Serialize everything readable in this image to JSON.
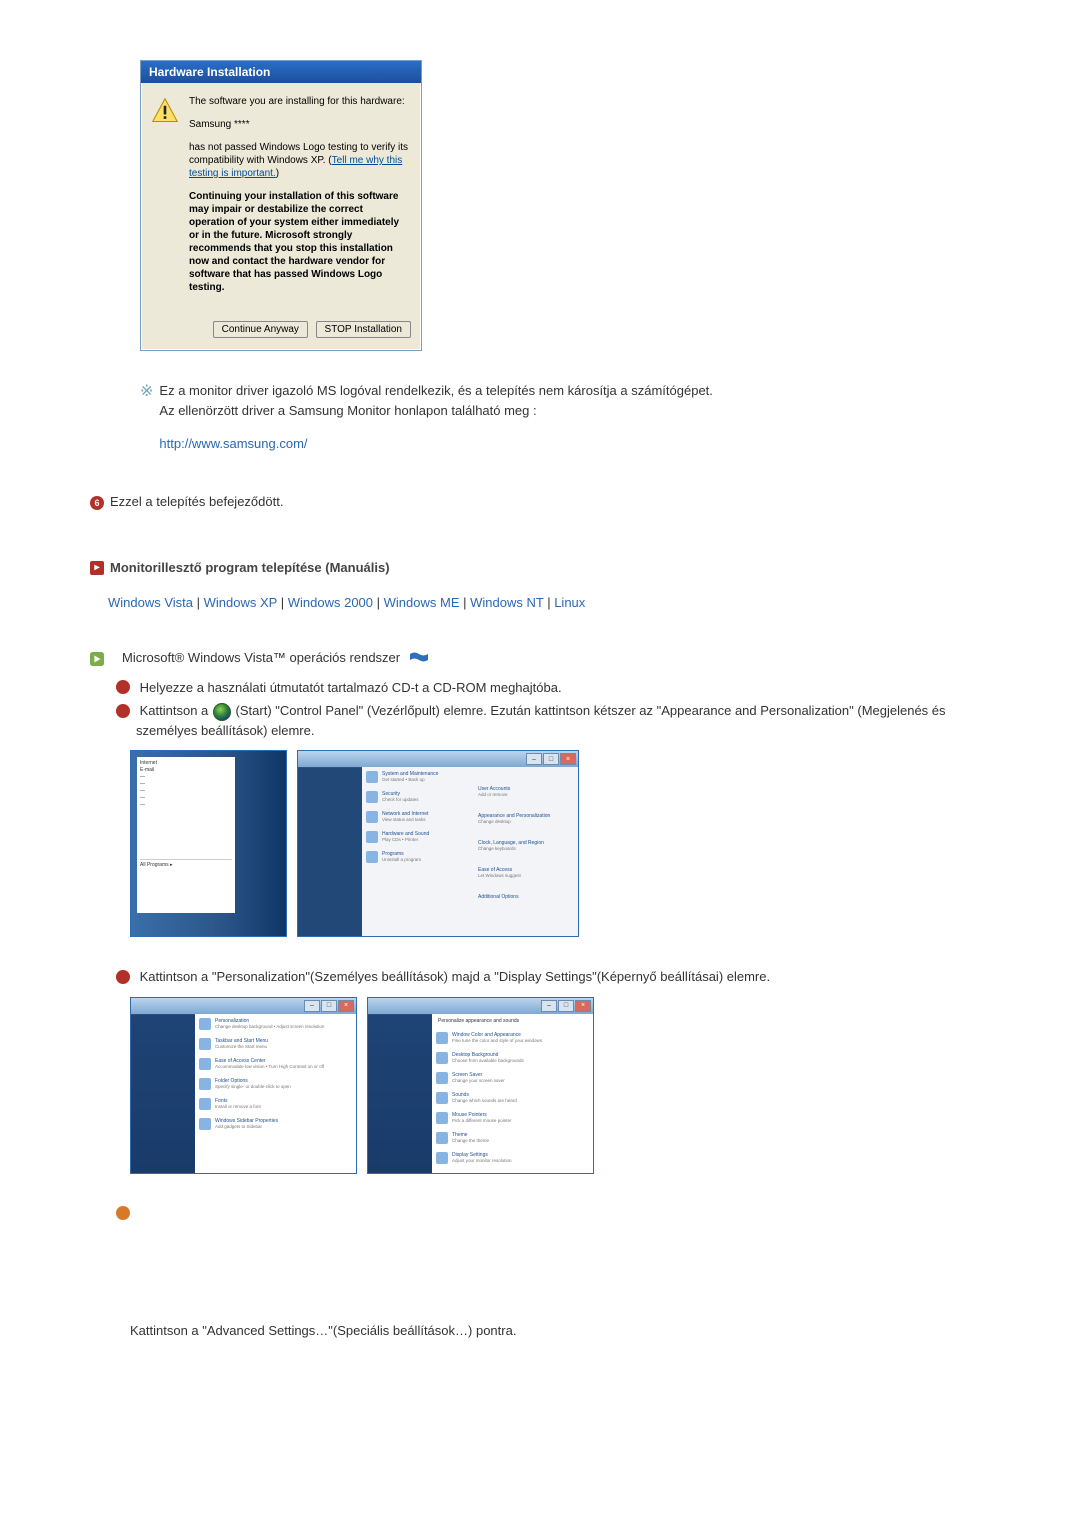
{
  "dialog": {
    "title": "Hardware Installation",
    "line1": "The software you are installing for this hardware:",
    "device": "Samsung ****",
    "line2a": "has not passed Windows Logo testing to verify its compatibility with Windows XP. (",
    "line2_link": "Tell me why this testing is important.",
    "line2b": ")",
    "bold_block": "Continuing your installation of this software may impair or destabilize the correct operation of your system either immediately or in the future. Microsoft strongly recommends that you stop this installation now and contact the hardware vendor for software that has passed Windows Logo testing.",
    "btn_continue": "Continue Anyway",
    "btn_stop": "STOP Installation"
  },
  "note1_line1": "Ez a monitor driver igazoló MS logóval rendelkezik, és a telepítés nem károsítja a számítógépet.",
  "note1_line2": "Az ellenörzött driver a Samsung Monitor honlapon található meg :",
  "note1_link": "http://www.samsung.com/",
  "step6": "Ezzel a telepítés befejeződött.",
  "section_title": "Monitorillesztő program telepítése (Manuális)",
  "os_links": {
    "vista": "Windows Vista",
    "xp": "Windows XP",
    "w2000": "Windows 2000",
    "me": "Windows ME",
    "nt": "Windows NT",
    "linux": "Linux"
  },
  "vista_line": "Microsoft® Windows Vista™ operációs rendszer",
  "vista_step1": "Helyezze a használati útmutatót tartalmazó CD-t a CD-ROM meghajtóba.",
  "vista_step2a": "Kattintson a ",
  "vista_step2b": "(Start) \"Control Panel\" (Vezérlőpult) elemre. Ezután kattintson kétszer az \"Appearance and Personalization\" (Megjelenés és személyes beállítások) elemre.",
  "vista_step3": "Kattintson a \"Personalization\"(Személyes beállítások) majd a \"Display Settings\"(Képernyő beállításai) elemre.",
  "vista_step4_bottom": "Kattintson a \"Advanced Settings…\"(Speciális beállítások…) pontra."
}
